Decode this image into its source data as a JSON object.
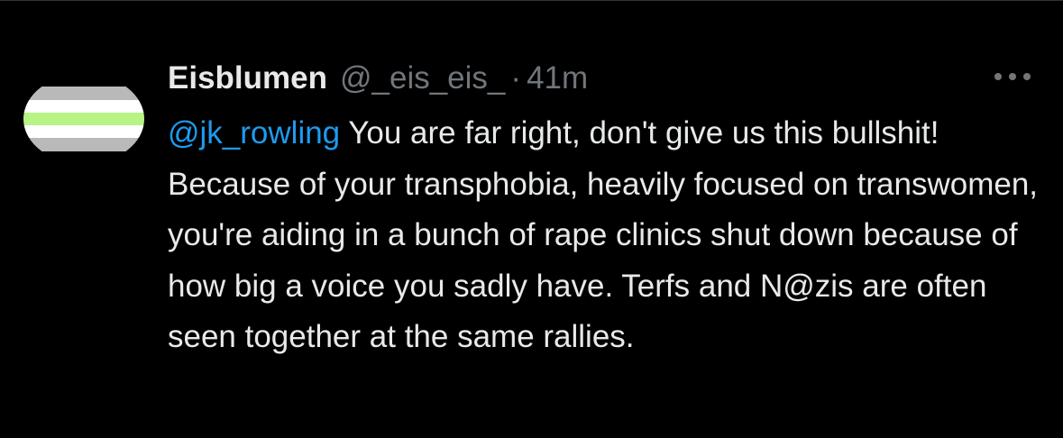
{
  "tweet": {
    "display_name": "Eisblumen",
    "handle": "@_eis_eis_",
    "separator": "·",
    "time": "41m",
    "mention": "@jk_rowling",
    "text": " You are far right, don't give us this bullshit! Because of your transphobia, heavily focused on transwomen, you're aiding in a bunch of rape clinics shut down because of how big a voice you sadly have. Terfs and N@zis are often seen together at the same rallies.",
    "more_icon": "more-horizontal-icon"
  },
  "avatar": {
    "stripe_colors": [
      "#000000",
      "#b9b9b9",
      "#ffffff",
      "#b8f483",
      "#ffffff",
      "#b9b9b9",
      "#000000"
    ]
  },
  "colors": {
    "background": "#000000",
    "text": "#e7e9ea",
    "secondary": "#71767b",
    "link": "#1d9bf0"
  }
}
